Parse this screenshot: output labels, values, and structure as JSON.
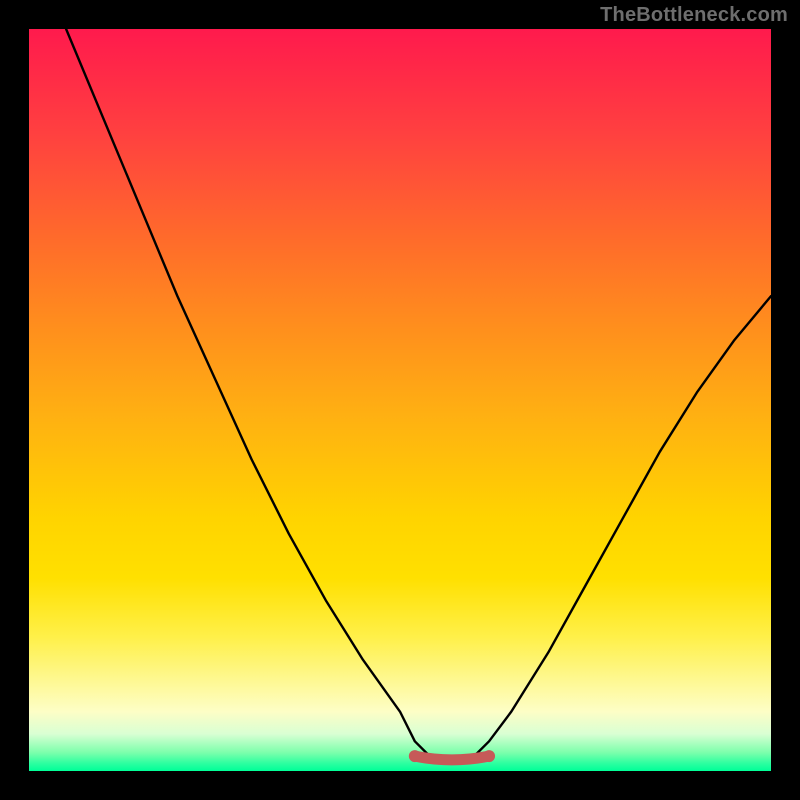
{
  "attribution": "TheBottleneck.com",
  "colors": {
    "curve": "#000000",
    "marker": "#c65a58",
    "gradient_stops": [
      {
        "pct": 0,
        "hex": "#ff1a4d"
      },
      {
        "pct": 14,
        "hex": "#ff4040"
      },
      {
        "pct": 28,
        "hex": "#ff6a2b"
      },
      {
        "pct": 40,
        "hex": "#ff8e1d"
      },
      {
        "pct": 52,
        "hex": "#ffb012"
      },
      {
        "pct": 66,
        "hex": "#ffd400"
      },
      {
        "pct": 82,
        "hex": "#fff04a"
      },
      {
        "pct": 92,
        "hex": "#fdfec6"
      },
      {
        "pct": 99,
        "hex": "#2bffa0"
      },
      {
        "pct": 100,
        "hex": "#00ff98"
      }
    ]
  },
  "chart_data": {
    "type": "line",
    "title": "",
    "xlabel": "",
    "ylabel": "",
    "xlim": [
      0,
      100
    ],
    "ylim": [
      0,
      100
    ],
    "series": [
      {
        "name": "bottleneck-curve",
        "x": [
          5,
          10,
          15,
          20,
          25,
          30,
          35,
          40,
          45,
          50,
          52,
          54,
          56,
          58,
          60,
          62,
          65,
          70,
          75,
          80,
          85,
          90,
          95,
          100
        ],
        "y": [
          100,
          88,
          76,
          64,
          53,
          42,
          32,
          23,
          15,
          8,
          4,
          2,
          1,
          1,
          2,
          4,
          8,
          16,
          25,
          34,
          43,
          51,
          58,
          64
        ]
      }
    ],
    "flat_zone": {
      "x_start": 52,
      "x_end": 62,
      "y": 2
    },
    "markers": [
      {
        "x": 52,
        "y": 2,
        "r": 6
      },
      {
        "x": 62,
        "y": 2,
        "r": 6
      }
    ]
  }
}
